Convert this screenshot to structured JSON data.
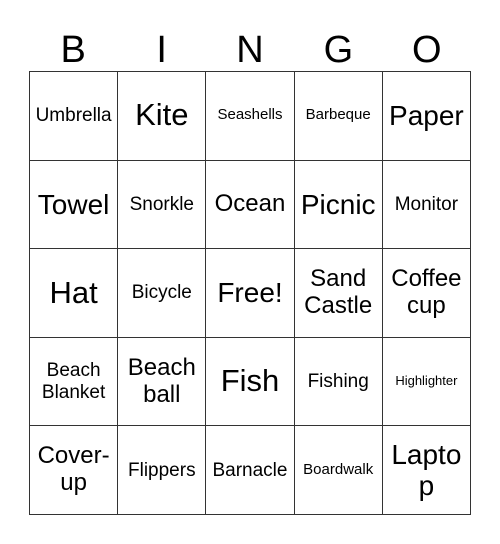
{
  "card": {
    "title": "BINGO",
    "headers": [
      "B",
      "I",
      "N",
      "G",
      "O"
    ],
    "free_space_label": "Free!",
    "colors": {
      "border": "#333333",
      "text": "#000000",
      "background": "#ffffff"
    },
    "rows": [
      [
        {
          "label": "Umbrella",
          "size": "sm"
        },
        {
          "label": "Kite",
          "size": "xl"
        },
        {
          "label": "Seashells",
          "size": "xs"
        },
        {
          "label": "Barbeque",
          "size": "xs"
        },
        {
          "label": "Paper",
          "size": "lg"
        }
      ],
      [
        {
          "label": "Towel",
          "size": "lg"
        },
        {
          "label": "Snorkle",
          "size": "sm"
        },
        {
          "label": "Ocean",
          "size": "md"
        },
        {
          "label": "Picnic",
          "size": "lg"
        },
        {
          "label": "Monitor",
          "size": "sm"
        }
      ],
      [
        {
          "label": "Hat",
          "size": "xl"
        },
        {
          "label": "Bicycle",
          "size": "sm"
        },
        {
          "label": "Free!",
          "size": "lg"
        },
        {
          "label": "Sand Castle",
          "size": "md"
        },
        {
          "label": "Coffee cup",
          "size": "md"
        }
      ],
      [
        {
          "label": "Beach Blanket",
          "size": "sm"
        },
        {
          "label": "Beach ball",
          "size": "md"
        },
        {
          "label": "Fish",
          "size": "xl"
        },
        {
          "label": "Fishing",
          "size": "sm"
        },
        {
          "label": "Highlighter",
          "size": "xxs"
        }
      ],
      [
        {
          "label": "Cover-up",
          "size": "md"
        },
        {
          "label": "Flippers",
          "size": "sm"
        },
        {
          "label": "Barnacle",
          "size": "sm"
        },
        {
          "label": "Boardwalk",
          "size": "xs"
        },
        {
          "label": "Laptop",
          "size": "lg"
        }
      ]
    ]
  }
}
